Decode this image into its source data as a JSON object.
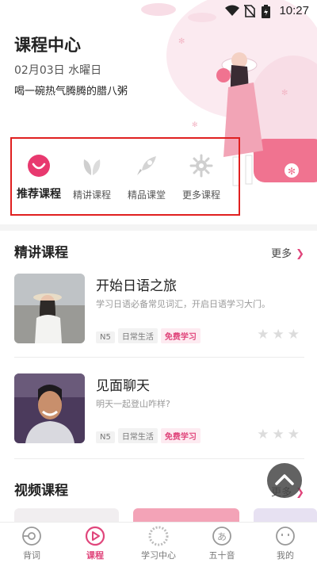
{
  "status_bar": {
    "time": "10:27"
  },
  "header": {
    "title": "课程中心",
    "date": "02月03日 水曜日",
    "slogan": "喝一碗热气腾腾的腊八粥"
  },
  "categories": [
    {
      "label": "推荐课程",
      "icon": "smile-icon",
      "active": true
    },
    {
      "label": "精讲课程",
      "icon": "leaf-icon",
      "active": false
    },
    {
      "label": "精品课堂",
      "icon": "rocket-icon",
      "active": false
    },
    {
      "label": "更多课程",
      "icon": "gear-icon",
      "active": false
    }
  ],
  "section_featured": {
    "title": "精讲课程",
    "more_label": "更多",
    "courses": [
      {
        "name": "开始日语之旅",
        "desc": "学习日语必备常见词汇，开启日语学习大门。",
        "tags": [
          "N5",
          "日常生活",
          "免费学习"
        ],
        "stars": "★★★"
      },
      {
        "name": "见面聊天",
        "desc": "明天一起登山咋样?",
        "tags": [
          "N5",
          "日常生活",
          "免费学习"
        ],
        "stars": "★★★"
      }
    ]
  },
  "section_video": {
    "title": "视频课程",
    "more_label": "更多"
  },
  "tabbar": [
    {
      "label": "背词",
      "icon": "target-icon",
      "active": false
    },
    {
      "label": "课程",
      "icon": "play-icon",
      "active": true
    },
    {
      "label": "学习中心",
      "icon": "wreath-icon",
      "active": false
    },
    {
      "label": "五十音",
      "icon": "kana-icon",
      "active": false
    },
    {
      "label": "我的",
      "icon": "face-icon",
      "active": false
    }
  ],
  "colors": {
    "accent": "#e0457b",
    "highlight_border": "#e02020"
  }
}
